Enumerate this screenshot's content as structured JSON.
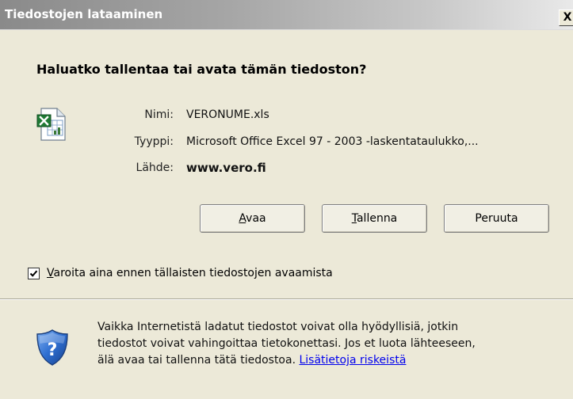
{
  "window": {
    "title": "Tiedostojen lataaminen",
    "close_glyph": "X"
  },
  "dialog": {
    "question": "Haluatko tallentaa tai avata tämän tiedoston?",
    "file_icon": "excel-file-icon",
    "fields": {
      "name_label": "Nimi:",
      "name_value": "VERONUME.xls",
      "type_label": "Tyyppi:",
      "type_value": "Microsoft Office Excel 97 - 2003 -laskentataulukko,...",
      "source_label": "Lähde:",
      "source_value": "www.vero.fi"
    },
    "buttons": {
      "open_accel": "A",
      "open_rest": "vaa",
      "save_accel": "T",
      "save_rest": "allenna",
      "cancel": "Peruuta"
    },
    "checkbox": {
      "checked": true,
      "label_accel": "V",
      "label_rest": "aroita aina ennen tällaisten tiedostojen avaamista"
    },
    "warning": {
      "icon": "shield-question-icon",
      "line1": "Vaikka Internetistä ladatut tiedostot voivat olla hyödyllisiä, jotkin",
      "line2": "tiedostot voivat vahingoittaa tietokonettasi. Jos et luota lähteeseen,",
      "line3_prefix": "älä avaa tai tallenna tätä tiedostoa. ",
      "link": "Lisätietoja riskeistä"
    }
  },
  "colors": {
    "dialog_bg": "#ece9d8",
    "link": "#0000ee"
  }
}
